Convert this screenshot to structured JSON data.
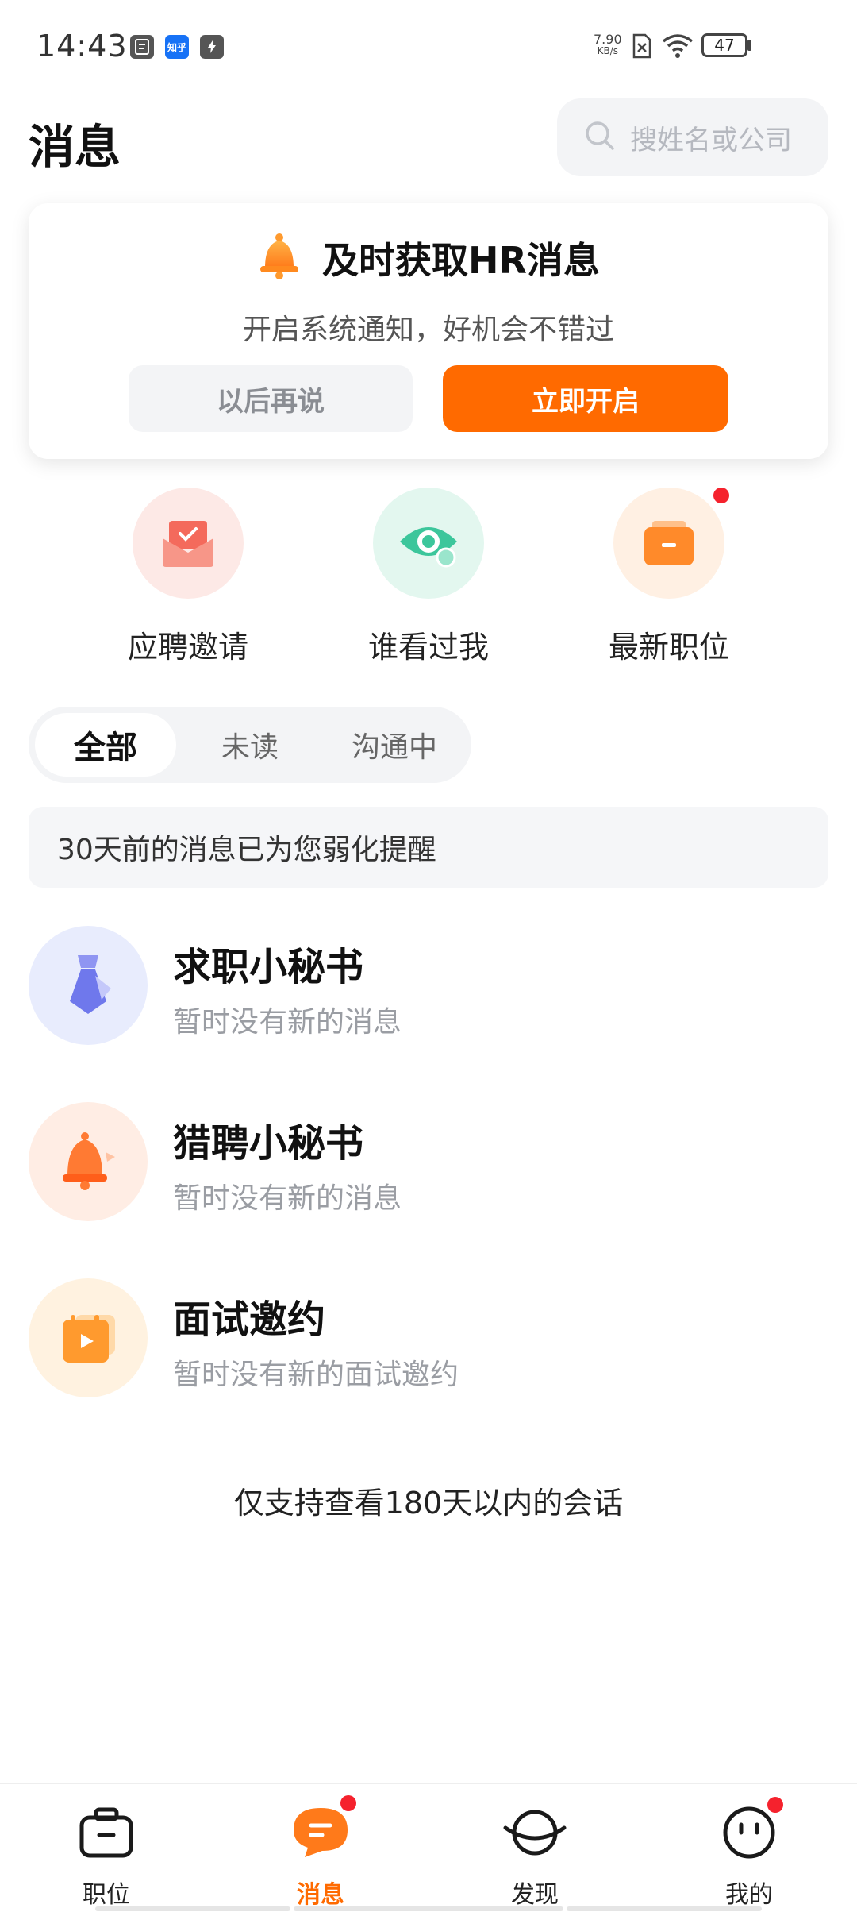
{
  "status_bar": {
    "time": "14:43",
    "app_icons": [
      "clipboard-app-icon",
      "zhihu-app-icon",
      "flash-app-icon"
    ],
    "zhihu_label": "知乎",
    "speed_value": "7.90",
    "speed_unit": "KB/s",
    "battery": "47"
  },
  "header": {
    "title": "消息",
    "search_placeholder": "搜姓名或公司"
  },
  "notify_card": {
    "title": "及时获取HR消息",
    "subtitle": "开启系统通知，好机会不错过",
    "later_label": "以后再说",
    "open_label": "立即开启"
  },
  "quick_entries": [
    {
      "label": "应聘邀请",
      "icon": "envelope-icon"
    },
    {
      "label": "谁看过我",
      "icon": "eye-icon"
    },
    {
      "label": "最新职位",
      "icon": "briefcase-icon",
      "badge": true
    }
  ],
  "filter_tabs": [
    {
      "label": "全部",
      "active": true
    },
    {
      "label": "未读",
      "active": false
    },
    {
      "label": "沟通中",
      "active": false
    }
  ],
  "tip": "30天前的消息已为您弱化提醒",
  "conversations": [
    {
      "title": "求职小秘书",
      "subtitle": "暂时没有新的消息",
      "icon": "tie-icon"
    },
    {
      "title": "猎聘小秘书",
      "subtitle": "暂时没有新的消息",
      "icon": "bell-icon"
    },
    {
      "title": "面试邀约",
      "subtitle": "暂时没有新的面试邀约",
      "icon": "video-calendar-icon"
    }
  ],
  "footer_note": "仅支持查看180天以内的会话",
  "bottom_nav": [
    {
      "label": "职位",
      "icon": "briefcase-outline-icon",
      "active": false
    },
    {
      "label": "消息",
      "icon": "chat-bubble-icon",
      "active": true,
      "badge": true
    },
    {
      "label": "发现",
      "icon": "planet-icon",
      "active": false
    },
    {
      "label": "我的",
      "icon": "smiley-icon",
      "active": false,
      "badge": true
    }
  ],
  "colors": {
    "accent": "#ff6a00",
    "badge": "#f5222d"
  }
}
